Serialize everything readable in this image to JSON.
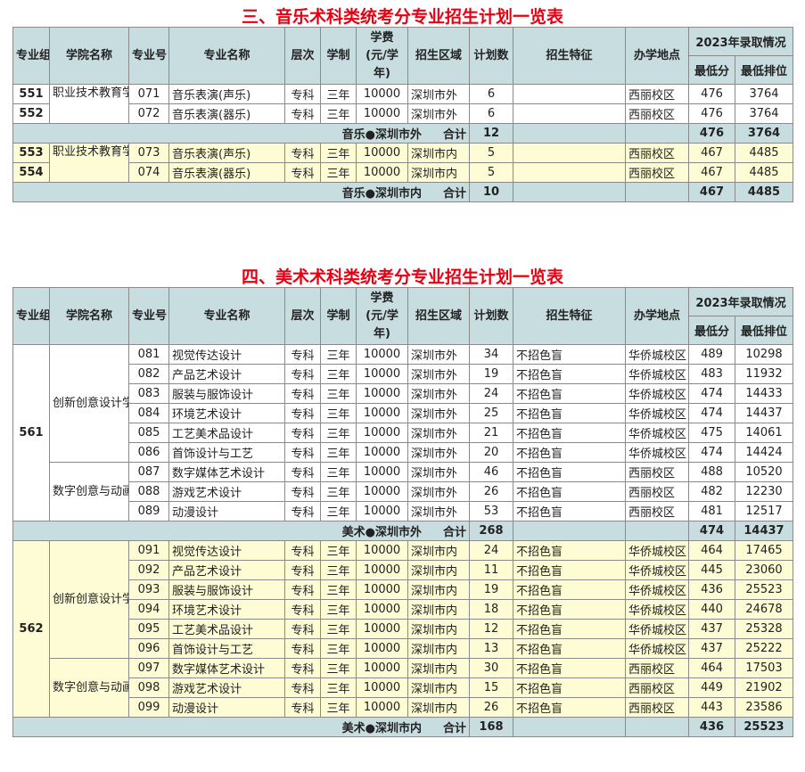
{
  "headers": {
    "group": "专业组",
    "college": "学院名称",
    "code": "专业号",
    "major": "专业名称",
    "level": "层次",
    "duration": "学制",
    "fee": "学费\n(元/学\n年)",
    "region": "招生区域",
    "plan": "计划数",
    "feature": "招生特征",
    "campus": "办学地点",
    "adm": "2023年录取情况",
    "minscore": "最低分",
    "minrank": "最低排位"
  },
  "music": {
    "title": "三、音乐术科类统考分专业招生计划一览表",
    "rows_out": [
      {
        "group": "551",
        "code": "071",
        "major": "音乐表演(声乐)",
        "level": "专科",
        "duration": "三年",
        "fee": "10000",
        "region": "深圳市外",
        "plan": "6",
        "feature": "",
        "campus": "西丽校区",
        "minscore": "476",
        "minrank": "3764"
      },
      {
        "group": "552",
        "code": "072",
        "major": "音乐表演(器乐)",
        "level": "专科",
        "duration": "三年",
        "fee": "10000",
        "region": "深圳市外",
        "plan": "6",
        "feature": "",
        "campus": "西丽校区",
        "minscore": "476",
        "minrank": "3764"
      }
    ],
    "college_out": "职业技术教育学院",
    "sum_out": {
      "label": "音乐●深圳市外",
      "total_label": "合计",
      "plan": "12",
      "minscore": "476",
      "minrank": "3764"
    },
    "rows_in": [
      {
        "group": "553",
        "code": "073",
        "major": "音乐表演(声乐)",
        "level": "专科",
        "duration": "三年",
        "fee": "10000",
        "region": "深圳市内",
        "plan": "5",
        "feature": "",
        "campus": "西丽校区",
        "minscore": "467",
        "minrank": "4485"
      },
      {
        "group": "554",
        "code": "074",
        "major": "音乐表演(器乐)",
        "level": "专科",
        "duration": "三年",
        "fee": "10000",
        "region": "深圳市内",
        "plan": "5",
        "feature": "",
        "campus": "西丽校区",
        "minscore": "467",
        "minrank": "4485"
      }
    ],
    "college_in": "职业技术教育学院",
    "sum_in": {
      "label": "音乐●深圳市内",
      "total_label": "合计",
      "plan": "10",
      "minscore": "467",
      "minrank": "4485"
    }
  },
  "art": {
    "title": "四、美术术科类统考分专业招生计划一览表",
    "group_out": "561",
    "college_a_out": "创新创意设计学院",
    "college_b_out": "数字创意与动画学院",
    "rows_out": [
      {
        "code": "081",
        "major": "视觉传达设计",
        "level": "专科",
        "duration": "三年",
        "fee": "10000",
        "region": "深圳市外",
        "plan": "34",
        "feature": "不招色盲",
        "campus": "华侨城校区",
        "minscore": "489",
        "minrank": "10298"
      },
      {
        "code": "082",
        "major": "产品艺术设计",
        "level": "专科",
        "duration": "三年",
        "fee": "10000",
        "region": "深圳市外",
        "plan": "19",
        "feature": "不招色盲",
        "campus": "华侨城校区",
        "minscore": "483",
        "minrank": "11932"
      },
      {
        "code": "083",
        "major": "服装与服饰设计",
        "level": "专科",
        "duration": "三年",
        "fee": "10000",
        "region": "深圳市外",
        "plan": "24",
        "feature": "不招色盲",
        "campus": "华侨城校区",
        "minscore": "474",
        "minrank": "14433"
      },
      {
        "code": "084",
        "major": "环境艺术设计",
        "level": "专科",
        "duration": "三年",
        "fee": "10000",
        "region": "深圳市外",
        "plan": "25",
        "feature": "不招色盲",
        "campus": "华侨城校区",
        "minscore": "474",
        "minrank": "14437"
      },
      {
        "code": "085",
        "major": "工艺美术品设计",
        "level": "专科",
        "duration": "三年",
        "fee": "10000",
        "region": "深圳市外",
        "plan": "21",
        "feature": "不招色盲",
        "campus": "华侨城校区",
        "minscore": "475",
        "minrank": "14061"
      },
      {
        "code": "086",
        "major": "首饰设计与工艺",
        "level": "专科",
        "duration": "三年",
        "fee": "10000",
        "region": "深圳市外",
        "plan": "20",
        "feature": "不招色盲",
        "campus": "华侨城校区",
        "minscore": "474",
        "minrank": "14424"
      },
      {
        "code": "087",
        "major": "数字媒体艺术设计",
        "level": "专科",
        "duration": "三年",
        "fee": "10000",
        "region": "深圳市外",
        "plan": "46",
        "feature": "不招色盲",
        "campus": "西丽校区",
        "minscore": "488",
        "minrank": "10520"
      },
      {
        "code": "088",
        "major": "游戏艺术设计",
        "level": "专科",
        "duration": "三年",
        "fee": "10000",
        "region": "深圳市外",
        "plan": "26",
        "feature": "不招色盲",
        "campus": "西丽校区",
        "minscore": "482",
        "minrank": "12230"
      },
      {
        "code": "089",
        "major": "动漫设计",
        "level": "专科",
        "duration": "三年",
        "fee": "10000",
        "region": "深圳市外",
        "plan": "53",
        "feature": "不招色盲",
        "campus": "西丽校区",
        "minscore": "481",
        "minrank": "12517"
      }
    ],
    "sum_out": {
      "label": "美术●深圳市外",
      "total_label": "合计",
      "plan": "268",
      "minscore": "474",
      "minrank": "14437"
    },
    "group_in": "562",
    "college_a_in": "创新创意设计学院",
    "college_b_in": "数字创意与动画学院",
    "rows_in": [
      {
        "code": "091",
        "major": "视觉传达设计",
        "level": "专科",
        "duration": "三年",
        "fee": "10000",
        "region": "深圳市内",
        "plan": "24",
        "feature": "不招色盲",
        "campus": "华侨城校区",
        "minscore": "464",
        "minrank": "17465"
      },
      {
        "code": "092",
        "major": "产品艺术设计",
        "level": "专科",
        "duration": "三年",
        "fee": "10000",
        "region": "深圳市内",
        "plan": "11",
        "feature": "不招色盲",
        "campus": "华侨城校区",
        "minscore": "445",
        "minrank": "23060"
      },
      {
        "code": "093",
        "major": "服装与服饰设计",
        "level": "专科",
        "duration": "三年",
        "fee": "10000",
        "region": "深圳市内",
        "plan": "19",
        "feature": "不招色盲",
        "campus": "华侨城校区",
        "minscore": "436",
        "minrank": "25523"
      },
      {
        "code": "094",
        "major": "环境艺术设计",
        "level": "专科",
        "duration": "三年",
        "fee": "10000",
        "region": "深圳市内",
        "plan": "18",
        "feature": "不招色盲",
        "campus": "华侨城校区",
        "minscore": "440",
        "minrank": "24678"
      },
      {
        "code": "095",
        "major": "工艺美术品设计",
        "level": "专科",
        "duration": "三年",
        "fee": "10000",
        "region": "深圳市内",
        "plan": "12",
        "feature": "不招色盲",
        "campus": "华侨城校区",
        "minscore": "437",
        "minrank": "25328"
      },
      {
        "code": "096",
        "major": "首饰设计与工艺",
        "level": "专科",
        "duration": "三年",
        "fee": "10000",
        "region": "深圳市内",
        "plan": "13",
        "feature": "不招色盲",
        "campus": "华侨城校区",
        "minscore": "437",
        "minrank": "25222"
      },
      {
        "code": "097",
        "major": "数字媒体艺术设计",
        "level": "专科",
        "duration": "三年",
        "fee": "10000",
        "region": "深圳市内",
        "plan": "30",
        "feature": "不招色盲",
        "campus": "西丽校区",
        "minscore": "464",
        "minrank": "17503"
      },
      {
        "code": "098",
        "major": "游戏艺术设计",
        "level": "专科",
        "duration": "三年",
        "fee": "10000",
        "region": "深圳市内",
        "plan": "15",
        "feature": "不招色盲",
        "campus": "西丽校区",
        "minscore": "449",
        "minrank": "21902"
      },
      {
        "code": "099",
        "major": "动漫设计",
        "level": "专科",
        "duration": "三年",
        "fee": "10000",
        "region": "深圳市内",
        "plan": "26",
        "feature": "不招色盲",
        "campus": "西丽校区",
        "minscore": "443",
        "minrank": "23586"
      }
    ],
    "sum_in": {
      "label": "美术●深圳市内",
      "total_label": "合计",
      "plan": "168",
      "minscore": "436",
      "minrank": "25523"
    }
  }
}
